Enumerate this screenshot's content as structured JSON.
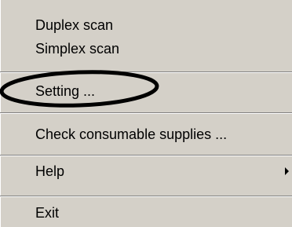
{
  "menu": {
    "items": [
      {
        "label": "Duplex scan"
      },
      {
        "label": "Simplex scan"
      },
      {
        "label": "Setting ..."
      },
      {
        "label": "Check consumable supplies ..."
      },
      {
        "label": "Help"
      },
      {
        "label": "Exit"
      }
    ]
  },
  "colors": {
    "menu_background": "#d4d0c8",
    "separator_dark": "#808080",
    "separator_light": "#ffffff",
    "annotation_stroke": "#000000"
  },
  "icons": {
    "submenu": "chevron-right-icon"
  }
}
